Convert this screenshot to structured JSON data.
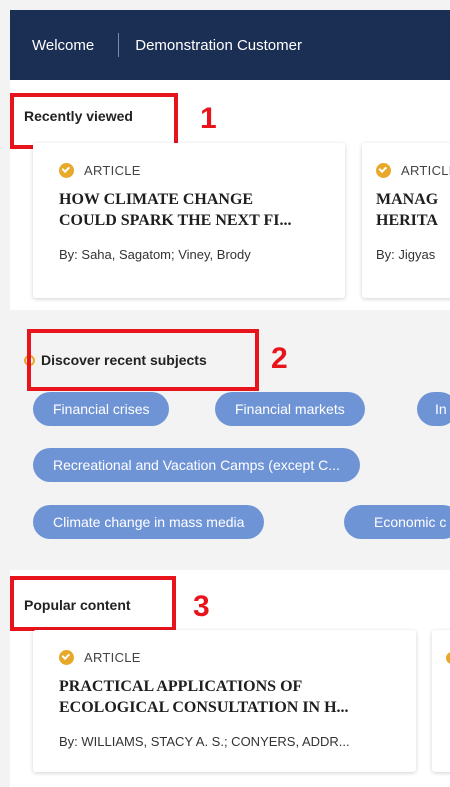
{
  "header": {
    "welcome": "Welcome",
    "customer": "Demonstration Customer"
  },
  "recently_viewed": {
    "title": "Recently viewed",
    "callout": "1",
    "cards": [
      {
        "type": "ARTICLE",
        "title": "HOW CLIMATE CHANGE\nCOULD SPARK THE NEXT FI...",
        "authors": "By: Saha, Sagatom; Viney, Brody"
      },
      {
        "type": "ARTICLE",
        "title": "MANAG\nHERITA",
        "authors": "By: Jigyas"
      }
    ]
  },
  "discover": {
    "title": "Discover recent subjects",
    "callout": "2",
    "chips": [
      "Financial crises",
      "Financial markets",
      "In",
      "Recreational and Vacation Camps (except C...",
      "Climate change in mass media",
      "Economic c"
    ]
  },
  "popular": {
    "title": "Popular content",
    "callout": "3",
    "cards": [
      {
        "type": "ARTICLE",
        "title": "PRACTICAL APPLICATIONS OF\nECOLOGICAL CONSULTATION IN H...",
        "authors": "By: WILLIAMS, STACY A. S.; CONYERS, ADDR..."
      }
    ]
  },
  "colors": {
    "header_bg": "#1b2f54",
    "chip_bg": "#6f94d6",
    "annotation_red": "#e8141c",
    "article_icon": "#e8a92b"
  }
}
